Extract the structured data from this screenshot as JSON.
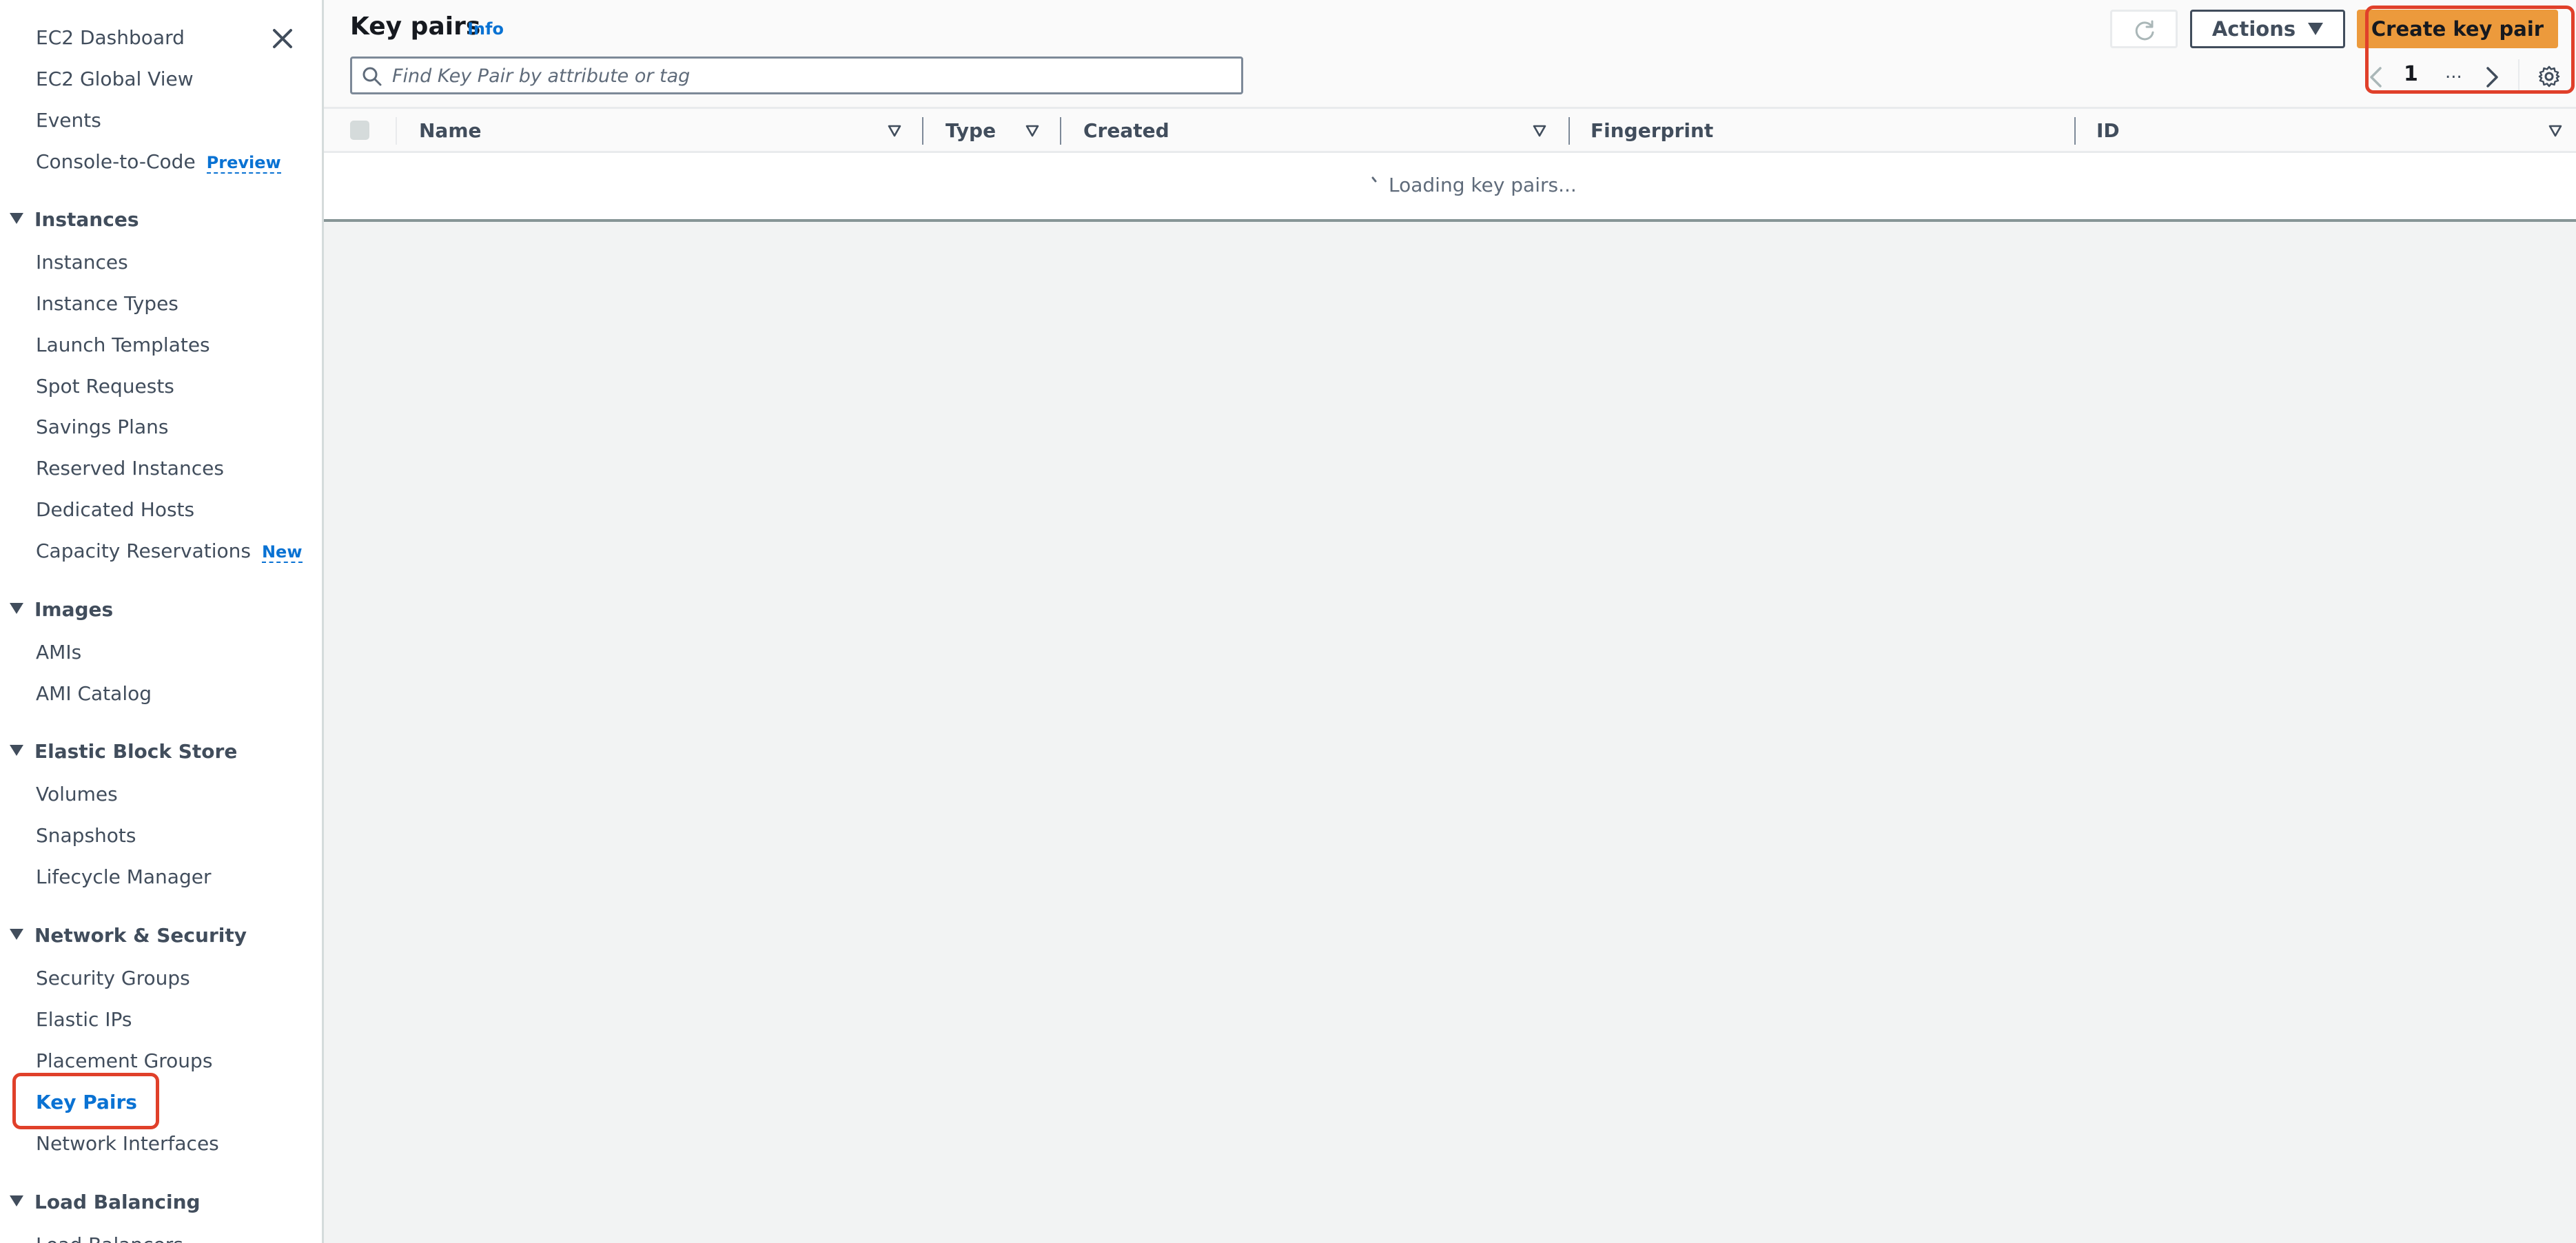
{
  "sidebar": {
    "top_items": [
      {
        "label": "EC2 Dashboard"
      },
      {
        "label": "EC2 Global View"
      },
      {
        "label": "Events"
      },
      {
        "label": "Console-to-Code",
        "badge": "Preview"
      }
    ],
    "sections": [
      {
        "title": "Instances",
        "items": [
          {
            "label": "Instances"
          },
          {
            "label": "Instance Types"
          },
          {
            "label": "Launch Templates"
          },
          {
            "label": "Spot Requests"
          },
          {
            "label": "Savings Plans"
          },
          {
            "label": "Reserved Instances"
          },
          {
            "label": "Dedicated Hosts"
          },
          {
            "label": "Capacity Reservations",
            "badge": "New"
          }
        ]
      },
      {
        "title": "Images",
        "items": [
          {
            "label": "AMIs"
          },
          {
            "label": "AMI Catalog"
          }
        ]
      },
      {
        "title": "Elastic Block Store",
        "items": [
          {
            "label": "Volumes"
          },
          {
            "label": "Snapshots"
          },
          {
            "label": "Lifecycle Manager"
          }
        ]
      },
      {
        "title": "Network & Security",
        "items": [
          {
            "label": "Security Groups"
          },
          {
            "label": "Elastic IPs"
          },
          {
            "label": "Placement Groups"
          },
          {
            "label": "Key Pairs",
            "active": true
          },
          {
            "label": "Network Interfaces"
          }
        ]
      },
      {
        "title": "Load Balancing",
        "items": [
          {
            "label": "Load Balancers"
          }
        ]
      }
    ]
  },
  "header": {
    "title": "Key pairs",
    "info_label": "Info",
    "search_placeholder": "Find Key Pair by attribute or tag",
    "search_value": "",
    "actions_label": "Actions",
    "create_label": "Create key pair",
    "pagination": {
      "current_page": "1",
      "ellipsis": "..."
    }
  },
  "table": {
    "columns": [
      {
        "label": "Name",
        "sortable": true
      },
      {
        "label": "Type",
        "sortable": true
      },
      {
        "label": "Created",
        "sortable": true
      },
      {
        "label": "Fingerprint",
        "sortable": false
      },
      {
        "label": "ID",
        "sortable": true
      }
    ],
    "loading_text": "Loading key pairs..."
  },
  "colors": {
    "accent_link": "#0972d3",
    "primary_button": "#ec9a3c",
    "annotation": "#e0402a",
    "text_secondary": "#414d5c",
    "page_bg": "#f2f3f3"
  }
}
